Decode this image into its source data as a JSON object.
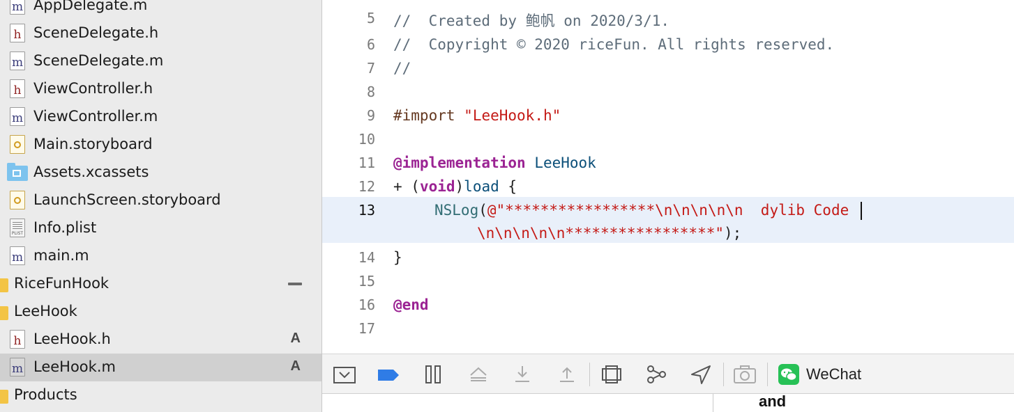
{
  "navigator": {
    "items": [
      {
        "label": "AppDelegate.m",
        "icon": "m"
      },
      {
        "label": "SceneDelegate.h",
        "icon": "h"
      },
      {
        "label": "SceneDelegate.m",
        "icon": "m"
      },
      {
        "label": "ViewController.h",
        "icon": "h"
      },
      {
        "label": "ViewController.m",
        "icon": "m"
      },
      {
        "label": "Main.storyboard",
        "icon": "storyboard"
      },
      {
        "label": "Assets.xcassets",
        "icon": "assets-folder"
      },
      {
        "label": "LaunchScreen.storyboard",
        "icon": "storyboard"
      },
      {
        "label": "Info.plist",
        "icon": "plist",
        "icon_text": "PLIST"
      },
      {
        "label": "main.m",
        "icon": "m"
      },
      {
        "label": "RiceFunHook",
        "icon": "group-folder"
      },
      {
        "label": "LeeHook",
        "icon": "group-folder"
      },
      {
        "label": "LeeHook.h",
        "icon": "h",
        "badge": "A"
      },
      {
        "label": "LeeHook.m",
        "icon": "m",
        "badge": "A",
        "selected": true
      },
      {
        "label": "Products",
        "icon": "group-folder"
      }
    ],
    "icon_letters": {
      "h": "h",
      "m": "m"
    }
  },
  "editor": {
    "line_numbers": [
      "5",
      "6",
      "7",
      "8",
      "9",
      "10",
      "11",
      "12",
      "13",
      "14",
      "15",
      "16",
      "17"
    ],
    "current_line": "13",
    "code": {
      "l5_comment": "//  Created by 鲍帆 on 2020/3/1.",
      "l6_comment": "//  Copyright © 2020 riceFun. All rights reserved.",
      "l7_comment": "//",
      "l9_directive": "#import",
      "l9_string": "\"LeeHook.h\"",
      "l11_keyword": "@implementation",
      "l11_class": "LeeHook",
      "l12_plus": "+ (",
      "l12_void": "void",
      "l12_close": ")",
      "l12_method": "load",
      "l12_brace": " {",
      "l13_func": "NSLog",
      "l13_open": "(",
      "l13_string_a": "@\"*****************\\n\\n\\n\\n\\n  dylib Code ",
      "l13_string_b": "\\n\\n\\n\\n\\n*****************\"",
      "l13_close": ");",
      "l14_brace": "}",
      "l16_keyword": "@end"
    }
  },
  "debug_bar": {
    "buttons": [
      "hide-debug-area",
      "breakpoints",
      "pause",
      "step-over",
      "step-into",
      "step-out",
      "debug-view-hierarchy",
      "memory-graph",
      "simulate-location",
      "environment-overrides"
    ],
    "process_label": "WeChat"
  },
  "console": {
    "visible_text": "and"
  },
  "colors": {
    "comment": "#5d6c79",
    "keyword": "#9b2393",
    "string": "#c41a16",
    "class": "#0b4f79",
    "highlight": "#e9f0fa",
    "sidebar_bg": "#ebebeb"
  }
}
